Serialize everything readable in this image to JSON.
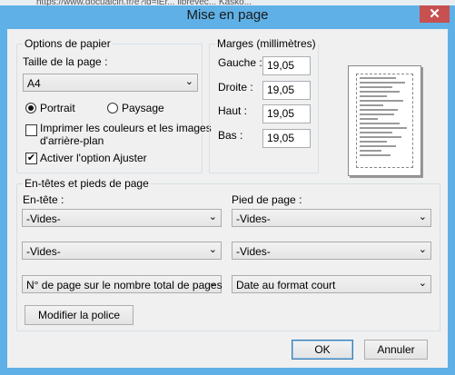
{
  "window": {
    "title": "Mise en page",
    "browser_strip_text": "https://www.docuaicin.fr/e?id=lEr... librevec... Kasko..."
  },
  "paper_options": {
    "group_label": "Options de papier",
    "page_size_label": "Taille de la page :",
    "page_size_value": "A4",
    "orientation": {
      "portrait_label": "Portrait",
      "landscape_label": "Paysage",
      "selected": "portrait"
    },
    "print_bg_label_line1": "Imprimer les couleurs et les images",
    "print_bg_label_line2": "d'arrière-plan",
    "print_bg_checked": false,
    "shrink_to_fit_label": "Activer l'option Ajuster",
    "shrink_to_fit_checked": true
  },
  "margins": {
    "group_label": "Marges (millimètres)",
    "left_label": "Gauche :",
    "left_value": "19,05",
    "right_label": "Droite :",
    "right_value": "19,05",
    "top_label": "Haut :",
    "top_value": "19,05",
    "bottom_label": "Bas :",
    "bottom_value": "19,05"
  },
  "headers_footers": {
    "group_label": "En-têtes et pieds de page",
    "header_label": "En-tête :",
    "footer_label": "Pied de page :",
    "header_1": "-Vides-",
    "header_2": "-Vides-",
    "header_3": "N° de page sur le nombre total de pages",
    "footer_1": "-Vides-",
    "footer_2": "-Vides-",
    "footer_3": "Date au format court",
    "change_font_label": "Modifier la police"
  },
  "buttons": {
    "ok_label": "OK",
    "cancel_label": "Annuler"
  },
  "icons": {
    "close": "close-icon",
    "dropdown": "chevron-down-icon"
  },
  "colors": {
    "titlebar": "#5fb0e6",
    "close_button": "#c75050",
    "dialog_background": "#f0f0f0"
  }
}
